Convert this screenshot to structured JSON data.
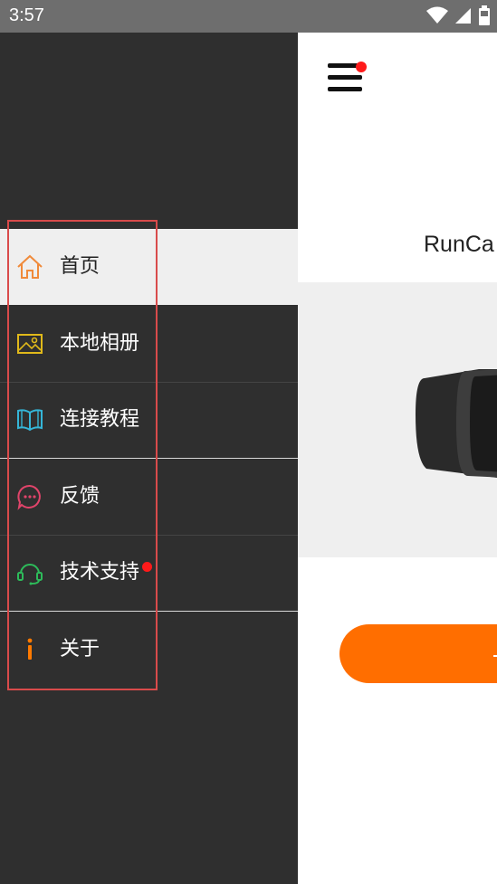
{
  "status_bar": {
    "time": "3:57",
    "icons": [
      "wifi-icon",
      "signal-icon",
      "battery-icon"
    ]
  },
  "main": {
    "device_title": "RunCa",
    "menu_badge_color": "#ff1a1a",
    "button_color": "#ff6e00"
  },
  "drawer": {
    "items": [
      {
        "label": "首页",
        "icon": "home-icon",
        "icon_color": "#f08a3a",
        "active": true
      },
      {
        "label": "本地相册",
        "icon": "image-icon",
        "icon_color": "#e0b91a"
      },
      {
        "label": "连接教程",
        "icon": "book-icon",
        "icon_color": "#35b6d8"
      },
      {
        "label": "反馈",
        "icon": "chat-icon",
        "icon_color": "#e0446a"
      },
      {
        "label": "技术支持",
        "icon": "headset-icon",
        "icon_color": "#2dbb5a",
        "badge": true
      },
      {
        "label": "关于",
        "icon": "info-icon",
        "icon_color": "#ff7a00"
      }
    ]
  }
}
